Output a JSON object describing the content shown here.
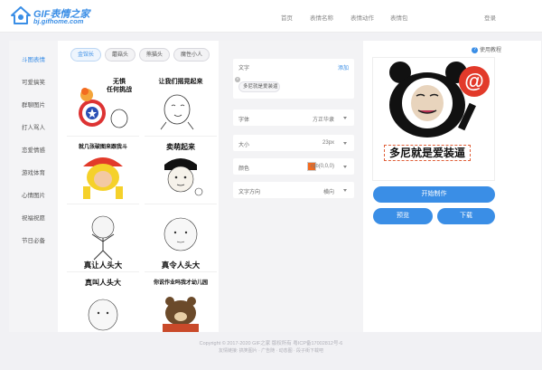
{
  "header": {
    "logo_name": "GIF表情之家",
    "logo_url": "bj.gifhome.com",
    "nav": [
      "首页",
      "表情名称",
      "表情动作",
      "表情包"
    ],
    "login": "登录"
  },
  "categories": [
    "斗图表情",
    "可爱搞笑",
    "群聊图片",
    "打人骂人",
    "恋爱情感",
    "游戏体育",
    "心情图片",
    "祝福祝愿",
    "节日必备"
  ],
  "sub_tabs": [
    "金馆长",
    "蘑菇头",
    "熊猫头",
    "魔性小人"
  ],
  "memes": [
    {
      "caption_top": "无惧",
      "caption_sub": "任何挑战",
      "caption_bottom": ""
    },
    {
      "caption_top": "让我们摇晃起来",
      "caption_sub": "",
      "caption_bottom": ""
    },
    {
      "caption_top": "就几张破图来跟我斗",
      "caption_sub": "",
      "caption_bottom": ""
    },
    {
      "caption_top": "卖萌起来",
      "caption_sub": "",
      "caption_bottom": ""
    },
    {
      "caption_top": "",
      "caption_sub": "",
      "caption_bottom": "真让人头大"
    },
    {
      "caption_top": "",
      "caption_sub": "",
      "caption_bottom": "真令人头大"
    },
    {
      "caption_top": "真叫人头大",
      "caption_sub": "",
      "caption_bottom": ""
    },
    {
      "caption_top": "你说作业吗我才幼儿园",
      "caption_sub": "",
      "caption_bottom": ""
    }
  ],
  "editor": {
    "text_label": "文字",
    "add_link": "添加",
    "text_value": "多尼就是爱装逼",
    "font_label": "字体",
    "font_value": "方正华隶",
    "size_label": "大小",
    "size_value": "23px",
    "color_label": "颜色",
    "color_value": "rgb(0,0,0)",
    "swatch_color": "#f36b20",
    "direction_label": "文字方向",
    "direction_value": "横向"
  },
  "preview": {
    "help": "使用教程",
    "caption": "多尼就是爱装逼",
    "make_button": "开始制作",
    "preview_button": "预览",
    "download_button": "下载"
  },
  "footer": {
    "copyright": "Copyright © 2017-2020 GIF之家 版权所有 粤ICP备17002812号-6",
    "links": "友情链接: 搞笑图片 · 广告随 · 动态图 · 段子街下载吧"
  },
  "colors": {
    "accent": "#3a8ee6"
  }
}
